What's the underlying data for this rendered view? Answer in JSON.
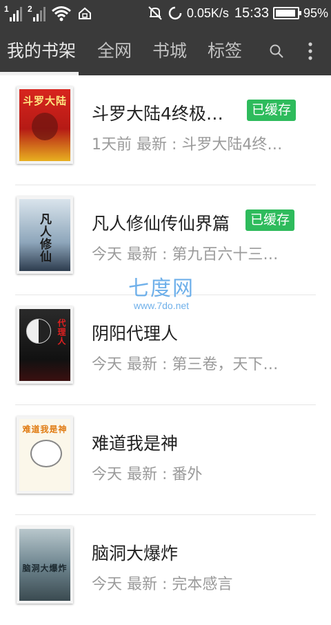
{
  "status_bar": {
    "sim1": "1",
    "sim2": "2",
    "net_speed": "0.05K/s",
    "time": "15:33",
    "battery_level": 0.95,
    "battery": "95%"
  },
  "tabs": [
    {
      "label": "我的书架",
      "active": true
    },
    {
      "label": "全网",
      "active": false
    },
    {
      "label": "书城",
      "active": false
    },
    {
      "label": "标签",
      "active": false
    }
  ],
  "icons": {
    "search": "search-icon",
    "more": "more-vertical-icon"
  },
  "accent": "#2ebb5c",
  "books": [
    {
      "title": "斗罗大陆4终极…",
      "meta": "1天前 最新 : 斗罗大陆4终…",
      "badge": "已缓存",
      "cover_text": "斗罗大陆"
    },
    {
      "title": "凡人修仙传仙界篇",
      "meta": "今天 最新 : 第九百六十三…",
      "badge": "已缓存",
      "cover_text": "凡人修仙"
    },
    {
      "title": "阴阳代理人",
      "meta": "今天 最新 : 第三卷，天下…",
      "badge": "",
      "cover_text": "代理人"
    },
    {
      "title": "难道我是神",
      "meta": "今天 最新 : 番外",
      "badge": "",
      "cover_text": "难道我是神"
    },
    {
      "title": "脑洞大爆炸",
      "meta": "今天 最新 : 完本感言",
      "badge": "",
      "cover_text": "脑洞大爆炸"
    }
  ],
  "watermark": {
    "title": "七度网",
    "url": "www.7do.net"
  }
}
